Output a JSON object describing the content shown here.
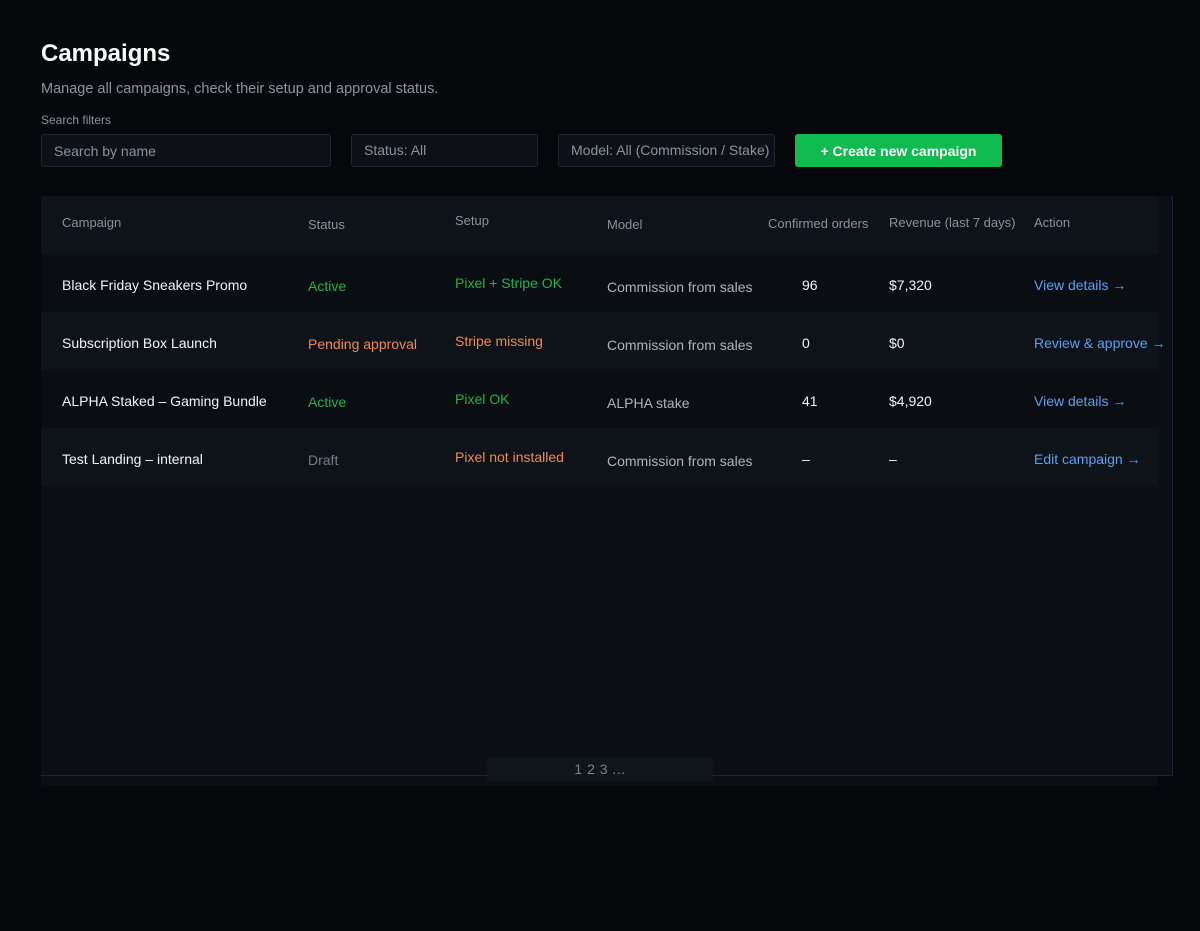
{
  "header": {
    "title": "Campaigns",
    "subtitle": "Manage all campaigns, check their setup and approval status."
  },
  "filters": {
    "label": "Search filters",
    "search_placeholder": "Search by name",
    "status_value": "Status: All",
    "model_value": "Model: All (Commission / Stake)",
    "create_label": "+ Create new campaign"
  },
  "table": {
    "columns": [
      "Campaign",
      "Status",
      "Setup",
      "Model",
      "Confirmed orders",
      "Revenue (last 7 days)",
      "Action"
    ],
    "rows": [
      {
        "campaign": "Black Friday Sneakers Promo",
        "status": "Active",
        "setup": "Pixel + Stripe OK",
        "model": "Commission from sales",
        "orders": "96",
        "revenue": "$7,320",
        "action": "View details →"
      },
      {
        "campaign": "Subscription Box Launch",
        "status": "Pending approval",
        "setup": "Stripe missing",
        "model": "Commission from sales",
        "orders": "0",
        "revenue": "$0",
        "action": "Review & approve →"
      },
      {
        "campaign": "ALPHA Staked – Gaming Bundle",
        "status": "Active",
        "setup": "Pixel OK",
        "model": "ALPHA stake",
        "orders": "41",
        "revenue": "$4,920",
        "action": "View details →"
      },
      {
        "campaign": "Test Landing – internal",
        "status": "Draft",
        "setup": "Pixel not installed",
        "model": "Commission from sales",
        "orders": "–",
        "revenue": "–",
        "action": "Edit campaign →"
      }
    ]
  },
  "pagination": {
    "label": "1 2 3 ..."
  },
  "colors": {
    "background": "#05070b",
    "accent_green": "#0fba4f",
    "status_active": "#22b04e",
    "status_warning": "#ee8a50",
    "status_draft": "#767c85",
    "link": "#5e9ff0"
  }
}
